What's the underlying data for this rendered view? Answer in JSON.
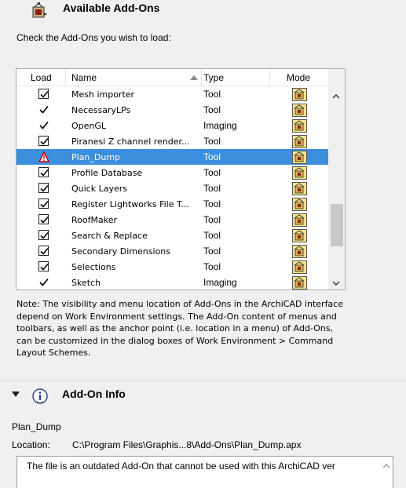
{
  "header": {
    "title": "Available Add-Ons",
    "icon": "addon-manager-icon"
  },
  "instruction": "Check the Add-Ons you wish to load:",
  "table": {
    "columns": {
      "load": "Load",
      "name": "Name",
      "type": "Type",
      "mode": "Mode"
    },
    "sort_column": "Name",
    "rows": [
      {
        "load": "checked",
        "name": "Mesh importer",
        "type": "Tool"
      },
      {
        "load": "tick",
        "name": "NecessaryLPs",
        "type": "Tool"
      },
      {
        "load": "tick",
        "name": "OpenGL",
        "type": "Imaging"
      },
      {
        "load": "checked",
        "name": "Piranesi Z channel render...",
        "type": "Tool"
      },
      {
        "load": "warning",
        "name": "Plan_Dump",
        "type": "Tool",
        "selected": true
      },
      {
        "load": "checked",
        "name": "Profile Database",
        "type": "Tool"
      },
      {
        "load": "checked",
        "name": "Quick Layers",
        "type": "Tool"
      },
      {
        "load": "checked",
        "name": "Register Lightworks File T...",
        "type": "Tool"
      },
      {
        "load": "checked",
        "name": "RoofMaker",
        "type": "Tool"
      },
      {
        "load": "checked",
        "name": "Search & Replace",
        "type": "Tool"
      },
      {
        "load": "checked",
        "name": "Secondary Dimensions",
        "type": "Tool"
      },
      {
        "load": "checked",
        "name": "Selections",
        "type": "Tool"
      },
      {
        "load": "tick",
        "name": "Sketch",
        "type": "Imaging"
      }
    ]
  },
  "note": "Note: The visibility and menu location of Add-Ons in the ArchiCAD interface depend on Work Environment settings. The Add-On content of menus and toolbars, as well as the anchor point (i.e. location in a menu) of Add-Ons, can be customized in the dialog boxes of Work Environment > Command Layout Schemes.",
  "info": {
    "title": "Add-On Info",
    "addon_name": "Plan_Dump",
    "location_label": "Location:",
    "location_value": "C:\\Program Files\\Graphis...8\\Add-Ons\\Plan_Dump.apx",
    "message": "The file is an outdated Add-On that cannot be used with this ArchiCAD ver"
  },
  "colors": {
    "selection": "#3c8fdc",
    "background": "#f0f0f0"
  }
}
